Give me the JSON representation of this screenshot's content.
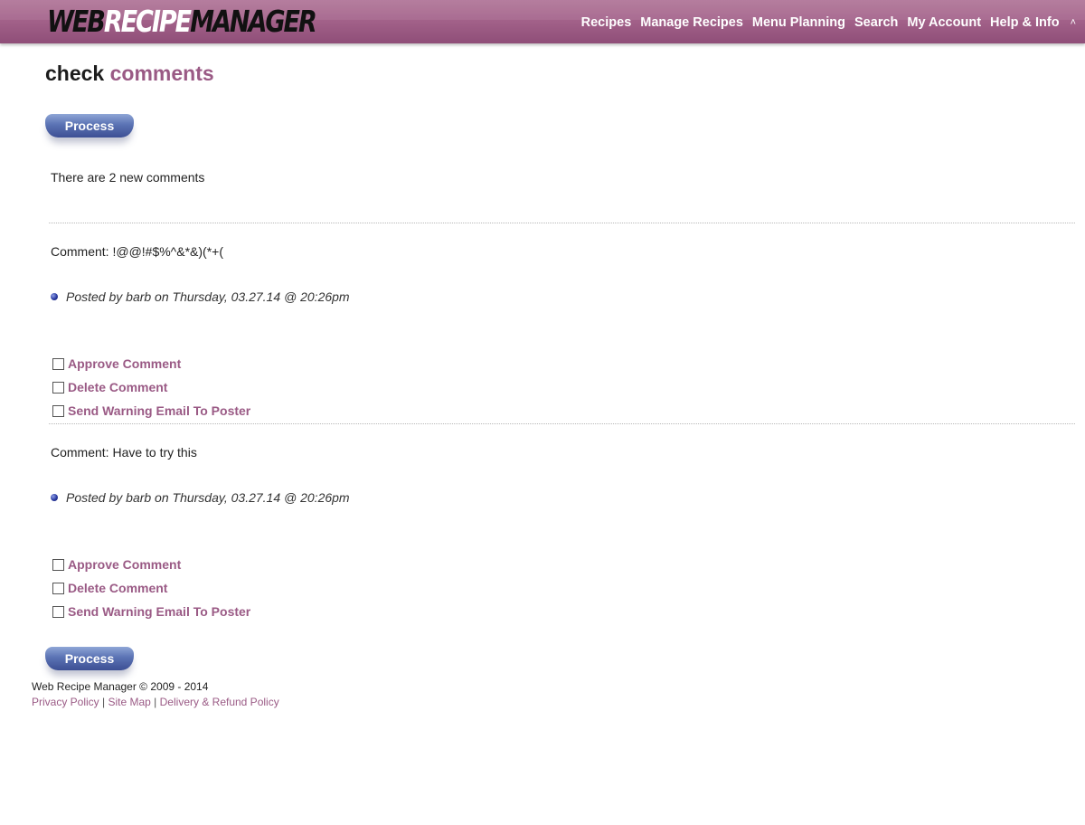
{
  "header": {
    "logo": {
      "part1": "WEB",
      "part2": "RECIPE",
      "part3": "MANAGER"
    },
    "nav": [
      {
        "label": "Recipes"
      },
      {
        "label": "Manage Recipes"
      },
      {
        "label": "Menu Planning"
      },
      {
        "label": "Search"
      },
      {
        "label": "My Account"
      },
      {
        "label": "Help & Info"
      }
    ],
    "caret_icon": "caret-up-icon",
    "caret_glyph": "˄"
  },
  "page": {
    "title_word1": "check",
    "title_word2": "comments",
    "process_label": "Process",
    "info_text": "There are 2 new comments"
  },
  "comments": [
    {
      "text": "Comment: !@@!#$%^&*&)(*+(",
      "posted": "Posted by barb on Thursday, 03.27.14 @ 20:26pm",
      "options": [
        "Approve Comment",
        "Delete Comment",
        "Send Warning Email To Poster"
      ]
    },
    {
      "text": "Comment: Have to try this",
      "posted": "Posted by barb on Thursday, 03.27.14 @ 20:26pm",
      "options": [
        "Approve Comment",
        "Delete Comment",
        "Send Warning Email To Poster"
      ]
    }
  ],
  "footer": {
    "copyright": "Web Recipe Manager © 2009 - 2014",
    "links": [
      "Privacy Policy",
      "Site Map",
      "Delivery & Refund Policy"
    ],
    "separator": " | "
  },
  "colors": {
    "header_bar": "#a3628a",
    "accent": "#9a5a85",
    "button": "#5b73b4"
  }
}
